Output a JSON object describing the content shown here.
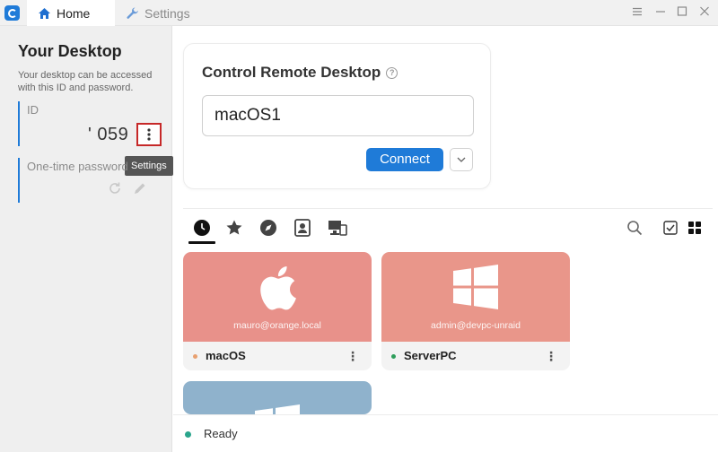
{
  "titlebar": {
    "tabs": [
      {
        "label": "Home",
        "icon": "home-icon",
        "active": true
      },
      {
        "label": "Settings",
        "icon": "wrench-icon",
        "active": false
      }
    ],
    "controls": [
      "menu-icon",
      "minimize-icon",
      "maximize-icon",
      "close-icon"
    ]
  },
  "left_panel": {
    "title": "Your Desktop",
    "description": "Your desktop can be accessed with this ID and password.",
    "id_label": "ID",
    "id_value": "' 059",
    "otp_label": "One-time password",
    "settings_tooltip": "Settings"
  },
  "remote": {
    "title": "Control Remote Desktop",
    "input_value": "macOS1",
    "connect_label": "Connect"
  },
  "peer_tabs": [
    "recent-icon",
    "favorites-icon",
    "discovered-icon",
    "address-book-icon",
    "accessible-devices-icon"
  ],
  "peers": [
    {
      "name": "macOS",
      "user": "mauro@orange.local",
      "os": "apple",
      "status_color": "#e8a070",
      "thumb_color": "#e8918a"
    },
    {
      "name": "ServerPC",
      "user": "admin@devpc-unraid",
      "os": "windows",
      "status_color": "#2e9e5b",
      "thumb_color": "#e9968a"
    },
    {
      "name": "",
      "user": "",
      "os": "windows",
      "status_color": "#2e9e5b",
      "thumb_color": "#8fb2cc"
    }
  ],
  "status": {
    "text": "Ready",
    "color": "#2aa58c"
  },
  "colors": {
    "accent": "#1f7bd8",
    "highlight_border": "#c62828"
  }
}
